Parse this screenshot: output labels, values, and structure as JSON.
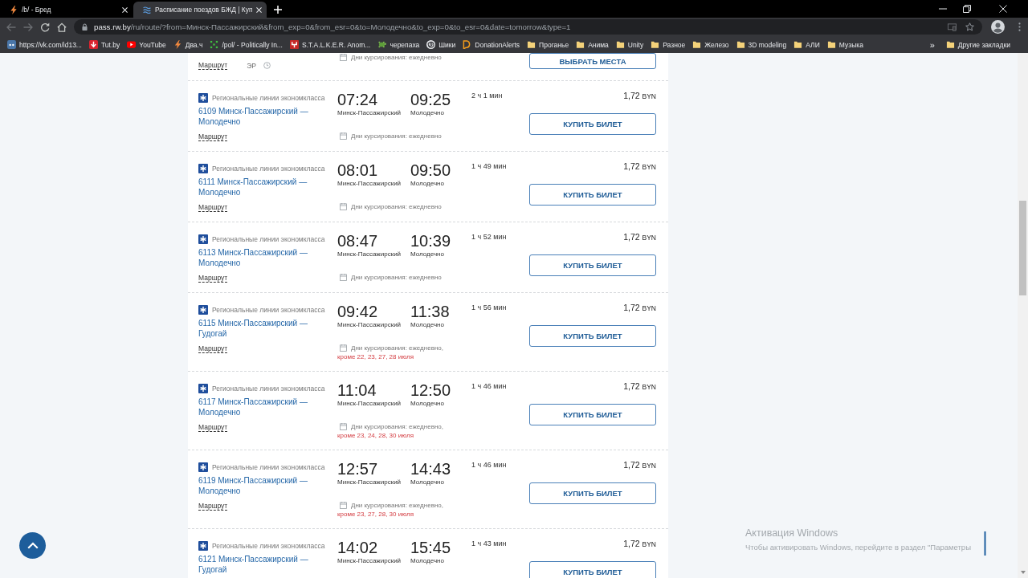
{
  "browser": {
    "tabs": [
      {
        "title": "/b/ - Бред",
        "kind": "bolt",
        "selected": false
      },
      {
        "title": "Расписание поездов БЖД | Куп",
        "kind": "waves",
        "selected": true
      }
    ],
    "nav": [
      {
        "kind": "back",
        "disabled": true
      },
      {
        "kind": "forward",
        "disabled": true
      },
      {
        "kind": "reload",
        "disabled": false
      },
      {
        "kind": "home",
        "disabled": false
      }
    ],
    "address": {
      "domain": "pass.rw.by",
      "path": "/ru/route/?from=Минск-Пассажирский&from_exp=0&from_esr=0&to=Молодечно&to_exp=0&to_esr=0&date=tomorrow&type=1"
    },
    "bookmarks": [
      {
        "label": "https://vk.com/id13...",
        "kind": "square"
      },
      {
        "label": "Tut.by",
        "kind": "arrowdown"
      },
      {
        "label": "YouTube",
        "kind": "play"
      },
      {
        "label": "Два.ч",
        "kind": "bolt"
      },
      {
        "label": "/pol/ - Politically In...",
        "kind": "dots"
      },
      {
        "label": "S.T.A.L.K.E.R. Anom...",
        "kind": "fork"
      },
      {
        "label": "черепаха",
        "kind": "turtle"
      },
      {
        "label": "Шики",
        "kind": "swirl"
      },
      {
        "label": "DonationAlerts",
        "kind": "bubble"
      },
      {
        "label": "Проганье",
        "kind": "folder"
      },
      {
        "label": "Анима",
        "kind": "folder"
      },
      {
        "label": "Unity",
        "kind": "folder"
      },
      {
        "label": "Разное",
        "kind": "folder"
      },
      {
        "label": "Железо",
        "kind": "folder"
      },
      {
        "label": "3D modeling",
        "kind": "folder"
      },
      {
        "label": "АЛИ",
        "kind": "folder"
      },
      {
        "label": "Музыка",
        "kind": "folder"
      }
    ],
    "more": "»",
    "other_bookmarks": "Другие закладки"
  },
  "partial_row": {
    "route_link": "Маршрут",
    "train_type": "ЭР",
    "days": "Дни курсирования: ежедневно",
    "button": "ВЫБРАТЬ МЕСТА"
  },
  "trains": [
    {
      "category": "Региональные линии экономкласса",
      "name": "6109 Минск-Пассажирский — Молодечно",
      "route_link": "Маршрут",
      "departure": "07:24",
      "from": "Минск-Пассажирский",
      "arrival": "09:25",
      "to": "Молодечно",
      "duration": "2 ч 1 мин",
      "price": "1,72",
      "currency": "BYN",
      "days": "Дни курсирования: ежедневно",
      "button": "КУПИТЬ БИЛЕТ"
    },
    {
      "category": "Региональные линии экономкласса",
      "name": "6111 Минск-Пассажирский — Молодечно",
      "route_link": "Маршрут",
      "departure": "08:01",
      "from": "Минск-Пассажирский",
      "arrival": "09:50",
      "to": "Молодечно",
      "duration": "1 ч 49 мин",
      "price": "1,72",
      "currency": "BYN",
      "days": "Дни курсирования: ежедневно",
      "button": "КУПИТЬ БИЛЕТ"
    },
    {
      "category": "Региональные линии экономкласса",
      "name": "6113 Минск-Пассажирский — Молодечно",
      "route_link": "Маршрут",
      "departure": "08:47",
      "from": "Минск-Пассажирский",
      "arrival": "10:39",
      "to": "Молодечно",
      "duration": "1 ч 52 мин",
      "price": "1,72",
      "currency": "BYN",
      "days": "Дни курсирования: ежедневно",
      "button": "КУПИТЬ БИЛЕТ"
    },
    {
      "category": "Региональные линии экономкласса",
      "name": "6115 Минск-Пассажирский — Гудогай",
      "route_link": "Маршрут",
      "departure": "09:42",
      "from": "Минск-Пассажирский",
      "arrival": "11:38",
      "to": "Молодечно",
      "duration": "1 ч 56 мин",
      "price": "1,72",
      "currency": "BYN",
      "days": "Дни курсирования: ежедневно,",
      "except": "кроме 22, 23, 27, 28 июля",
      "button": "КУПИТЬ БИЛЕТ"
    },
    {
      "category": "Региональные линии экономкласса",
      "name": "6117 Минск-Пассажирский — Молодечно",
      "route_link": "Маршрут",
      "departure": "11:04",
      "from": "Минск-Пассажирский",
      "arrival": "12:50",
      "to": "Молодечно",
      "duration": "1 ч 46 мин",
      "price": "1,72",
      "currency": "BYN",
      "days": "Дни курсирования: ежедневно,",
      "except": "кроме 23, 24, 28, 30 июля",
      "button": "КУПИТЬ БИЛЕТ"
    },
    {
      "category": "Региональные линии экономкласса",
      "name": "6119 Минск-Пассажирский — Молодечно",
      "route_link": "Маршрут",
      "departure": "12:57",
      "from": "Минск-Пассажирский",
      "arrival": "14:43",
      "to": "Молодечно",
      "duration": "1 ч 46 мин",
      "price": "1,72",
      "currency": "BYN",
      "days": "Дни курсирования: ежедневно,",
      "except": "кроме 23, 27, 28, 30 июля",
      "button": "КУПИТЬ БИЛЕТ"
    },
    {
      "category": "Региональные линии экономкласса",
      "name": "6121 Минск-Пассажирский — Гудогай",
      "departure": "14:02",
      "from": "Минск-Пассажирский",
      "arrival": "15:45",
      "to": "Молодечно",
      "duration": "1 ч 43 мин",
      "price": "1,72",
      "currency": "BYN",
      "button": "КУПИТЬ БИЛЕТ"
    }
  ],
  "windows_notice": {
    "title": "Активация Windows",
    "text": "Чтобы активировать Windows, перейдите в раздел \"Параметры"
  }
}
